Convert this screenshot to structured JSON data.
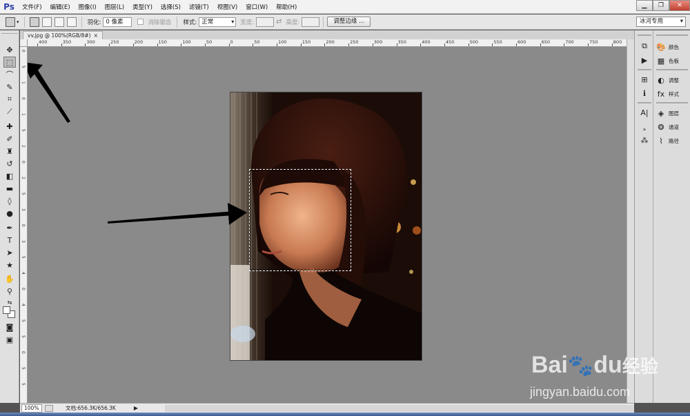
{
  "app": {
    "logo_text": "Ps",
    "menu": [
      "文件(F)",
      "编辑(E)",
      "图像(I)",
      "图层(L)",
      "类型(Y)",
      "选择(S)",
      "滤镜(T)",
      "视图(V)",
      "窗口(W)",
      "帮助(H)"
    ],
    "window_controls": [
      "▁",
      "❐",
      "✕"
    ]
  },
  "options_bar": {
    "feather_label": "羽化:",
    "feather_value": "0 像素",
    "antialias_label": "消除锯齿",
    "style_label": "样式:",
    "style_value": "正常",
    "width_label": "宽度:",
    "height_label": "高度:",
    "refine_edge_label": "调整边缘 ...",
    "workspace_value": "冰河专用"
  },
  "document": {
    "tab_title": "vv.jpg @ 100%(RGB/8#)",
    "tab_close": "×"
  },
  "ruler_top_labels": [
    "400",
    "350",
    "300",
    "250",
    "200",
    "150",
    "100",
    "50",
    "0",
    "50",
    "100",
    "150",
    "200",
    "250",
    "300",
    "350",
    "400",
    "450",
    "500",
    "550",
    "600",
    "650",
    "700",
    "750",
    "800"
  ],
  "ruler_left_labels": [
    "0",
    "5",
    "1",
    "0",
    "1",
    "5",
    "2",
    "0",
    "2",
    "5",
    "3",
    "0",
    "3",
    "5",
    "4",
    "0",
    "4",
    "5",
    "5",
    "0",
    "5",
    "5"
  ],
  "right_panels": {
    "group1": [
      {
        "label": "颜色",
        "icon": "color-palette-icon"
      },
      {
        "label": "色板",
        "icon": "swatches-icon"
      }
    ],
    "group2": [
      {
        "label": "调整",
        "icon": "adjustments-icon"
      },
      {
        "label": "样式",
        "icon": "styles-icon"
      }
    ],
    "group3": [
      {
        "label": "图层",
        "icon": "layers-icon"
      },
      {
        "label": "通道",
        "icon": "channels-icon"
      },
      {
        "label": "路径",
        "icon": "paths-icon"
      }
    ]
  },
  "status": {
    "zoom": "100%",
    "doc_info": "文档:656.3K/656.3K",
    "arrow": "▶"
  },
  "watermark": {
    "brand": "Bai",
    "brand_cn": "经验",
    "brand_du": "du",
    "url": "jingyan.baidu.com"
  },
  "colors": {
    "canvas_bg": "#8a8a8a",
    "panel_bg": "#dcdcdc",
    "menubar_bg": "#f2f2f2",
    "ps_blue": "#2b3fa8"
  }
}
